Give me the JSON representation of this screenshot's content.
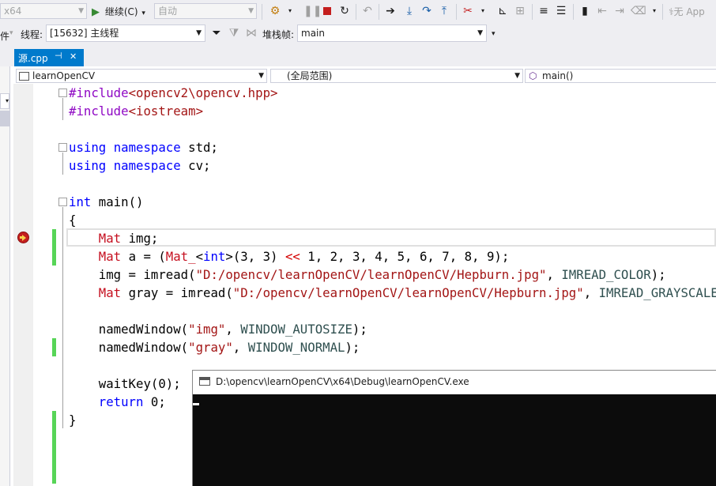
{
  "toolbar": {
    "platform": "x64",
    "continue_label": "继续(C)",
    "continue_arrow": "▾",
    "auto_label": "自动",
    "no_app_label": "无 App"
  },
  "debug_bar": {
    "thread_label": "线程:",
    "thread_value": "[15632] 主线程",
    "stack_label": "堆栈帧:",
    "stack_value": "main",
    "left_cut_label": "件"
  },
  "tabs": [
    {
      "label": "源.cpp",
      "pin": "⊣",
      "close": "✕"
    }
  ],
  "nav": {
    "project": "learnOpenCV",
    "scope": "(全局范围)",
    "function": "main()"
  },
  "code": {
    "l1": [
      "#include",
      "<opencv2\\opencv.hpp>"
    ],
    "l2": [
      "#include",
      "<iostream>"
    ],
    "l4": [
      "using",
      " ",
      "namespace",
      " std;"
    ],
    "l5": [
      "using",
      " ",
      "namespace",
      " cv;"
    ],
    "l7": [
      "int",
      " main()"
    ],
    "l8": "{",
    "l9": [
      "    ",
      "Mat",
      " img;"
    ],
    "l10": [
      "    ",
      "Mat",
      " a = (",
      "Mat_",
      "<",
      "int",
      ">(3, 3) ",
      "<<",
      " 1, 2, 3, 4, 5, 6, 7, 8, 9);"
    ],
    "l11": [
      "    img = imread(",
      "\"D:/opencv/learnOpenCV/learnOpenCV/Hepburn.jpg\"",
      ", ",
      "IMREAD_COLOR",
      ");"
    ],
    "l12": [
      "    ",
      "Mat",
      " gray = imread(",
      "\"D:/opencv/learnOpenCV/learnOpenCV/Hepburn.jpg\"",
      ", ",
      "IMREAD_GRAYSCALE"
    ],
    "l14": [
      "    namedWindow(",
      "\"img\"",
      ", ",
      "WINDOW_AUTOSIZE",
      ");"
    ],
    "l15": [
      "    namedWindow(",
      "\"gray\"",
      ", ",
      "WINDOW_NORMAL",
      ");"
    ],
    "l17": "    waitKey(0);",
    "l18": [
      "    ",
      "return",
      " 0;"
    ],
    "l19": "}"
  },
  "console": {
    "title": "D:\\opencv\\learnOpenCV\\x64\\Debug\\learnOpenCV.exe"
  },
  "colors": {
    "accent": "#007acc",
    "breakpoint_arrow": "#e51400",
    "change_bar": "#57d557"
  }
}
